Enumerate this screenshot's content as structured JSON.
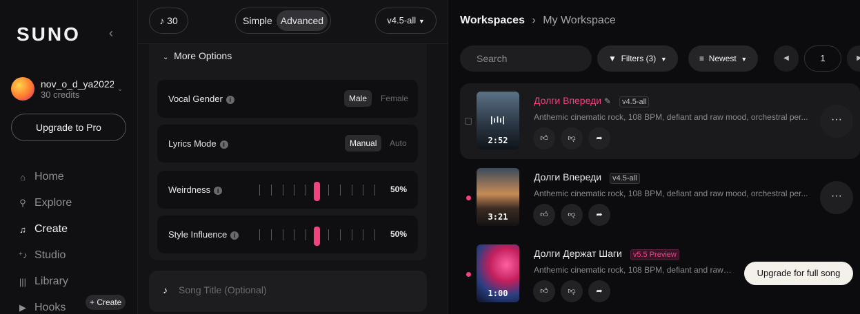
{
  "sidebar": {
    "logo": "SUNO",
    "user": {
      "name": "nov_o_d_ya2022",
      "credits": "30 credits"
    },
    "upgrade_label": "Upgrade to Pro",
    "nav": [
      {
        "label": "Home",
        "icon": "home-icon"
      },
      {
        "label": "Explore",
        "icon": "search-icon"
      },
      {
        "label": "Create",
        "icon": "music-note-icon"
      },
      {
        "label": "Studio",
        "icon": "studio-icon"
      },
      {
        "label": "Library",
        "icon": "library-icon"
      },
      {
        "label": "Hooks",
        "icon": "play-square-icon"
      }
    ],
    "hooks_create": "+ Create"
  },
  "create_panel": {
    "credits": "30",
    "modes": [
      "Simple",
      "Advanced"
    ],
    "active_mode": "Advanced",
    "version": "v4.5-all",
    "more_options": "More Options",
    "vocal_gender": {
      "label": "Vocal Gender",
      "options": [
        "Male",
        "Female"
      ],
      "selected": "Male"
    },
    "lyrics_mode": {
      "label": "Lyrics Mode",
      "options": [
        "Manual",
        "Auto"
      ],
      "selected": "Manual"
    },
    "weirdness": {
      "label": "Weirdness",
      "value": "50%"
    },
    "style_influence": {
      "label": "Style Influence",
      "value": "50%"
    },
    "song_title_placeholder": "Song Title (Optional)"
  },
  "workspace": {
    "breadcrumb": [
      "Workspaces",
      "My Workspace"
    ],
    "search_placeholder": "Search",
    "filters_label": "Filters (3)",
    "sort_label": "Newest",
    "page": "1",
    "songs": [
      {
        "title": "Долги Впереди",
        "tag": "v4.5-all",
        "desc": "Anthemic cinematic rock, 108 BPM, defiant and raw mood, orchestral per...",
        "duration": "2:52"
      },
      {
        "title": "Долги Впереди",
        "tag": "v4.5-all",
        "desc": "Anthemic cinematic rock, 108 BPM, defiant and raw mood, orchestral per...",
        "duration": "3:21"
      },
      {
        "title": "Долги Держат Шаги",
        "tag": "v5.5 Preview",
        "desc": "Anthemic cinematic rock, 108 BPM, defiant and raw m...",
        "duration": "1:00"
      }
    ],
    "upgrade_full_song": "Upgrade for full song"
  },
  "colors": {
    "accent": "#f2437f",
    "background": "#0c0c0e"
  }
}
